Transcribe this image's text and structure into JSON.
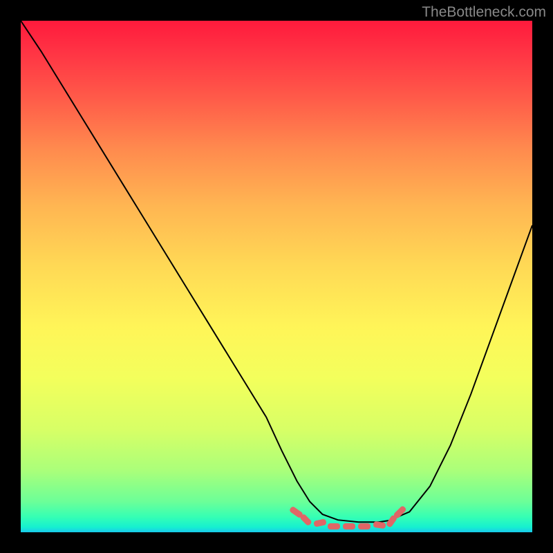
{
  "watermark": "TheBottleneck.com",
  "chart_data": {
    "type": "line",
    "title": "",
    "xlabel": "",
    "ylabel": "",
    "xlim": [
      0,
      100
    ],
    "ylim": [
      0,
      100
    ],
    "series": [
      {
        "name": "curve",
        "x": [
          0,
          4,
          8,
          12,
          16,
          20,
          24,
          28,
          32,
          36,
          40,
          44,
          48,
          51,
          54,
          56.5,
          59,
          62,
          66,
          70,
          72,
          76,
          80,
          84,
          88,
          92,
          96,
          100
        ],
        "y": [
          100,
          94,
          87.5,
          81,
          74.5,
          68,
          61.5,
          55,
          48.5,
          42,
          35.5,
          29,
          22.5,
          16,
          10,
          6,
          3.5,
          2.4,
          2.0,
          2.0,
          2.3,
          4,
          9,
          17,
          27,
          38,
          49,
          60
        ]
      }
    ],
    "optimal_range": {
      "x_start": 54,
      "x_end": 73,
      "y": 2.0
    },
    "annotations": []
  },
  "colors": {
    "curve": "#000000",
    "dash": "#e06666",
    "background_frame": "#000000"
  }
}
